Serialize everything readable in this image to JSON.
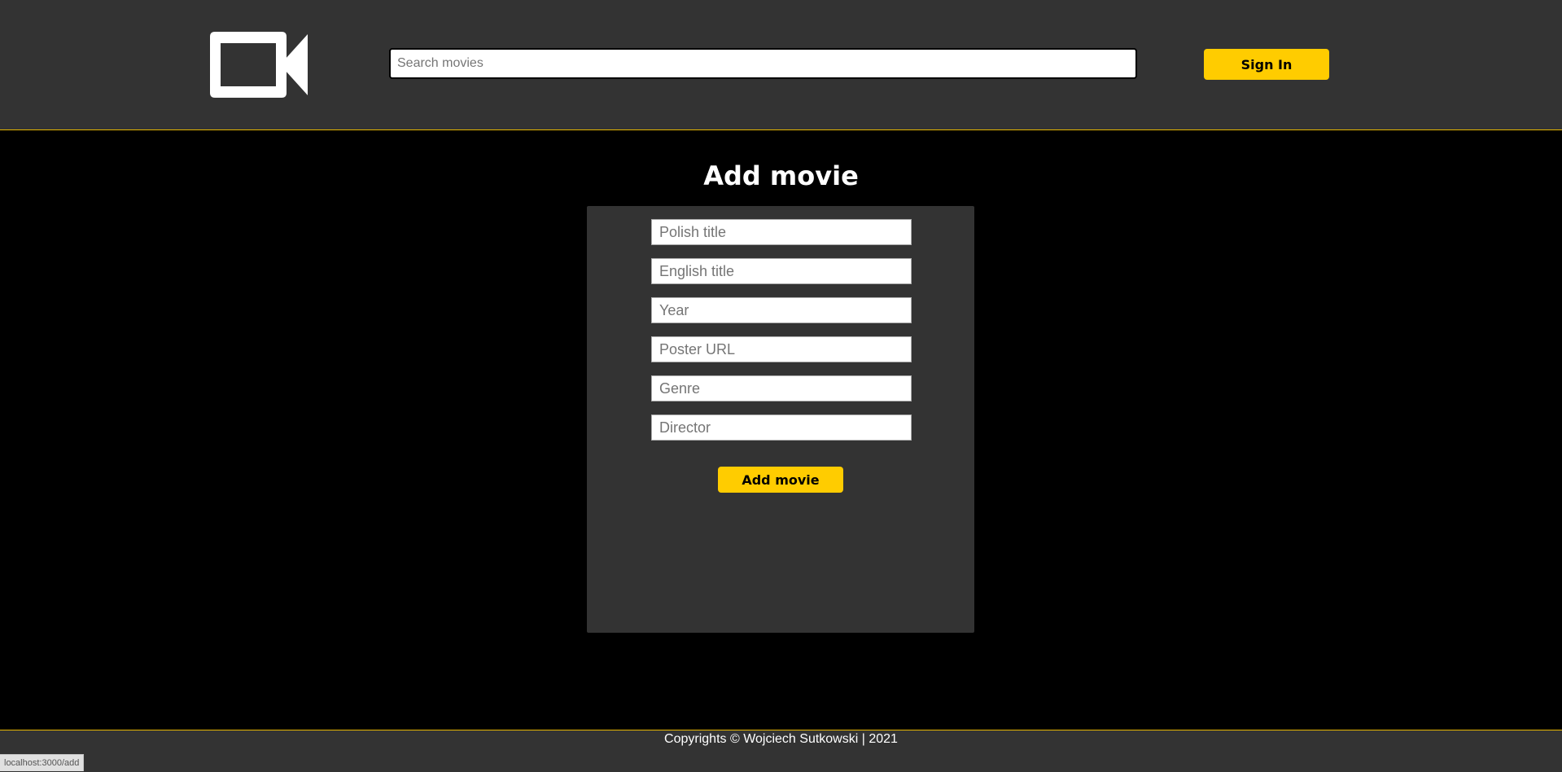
{
  "header": {
    "logo_icon": "video-camera-icon",
    "search_placeholder": "Search movies",
    "signin_label": "Sign In"
  },
  "main": {
    "title": "Add movie",
    "form": {
      "fields": [
        {
          "placeholder": "Polish title",
          "value": ""
        },
        {
          "placeholder": "English title",
          "value": ""
        },
        {
          "placeholder": "Year",
          "value": ""
        },
        {
          "placeholder": "Poster URL",
          "value": ""
        },
        {
          "placeholder": "Genre",
          "value": ""
        },
        {
          "placeholder": "Director",
          "value": ""
        }
      ],
      "submit_label": "Add movie"
    }
  },
  "footer": {
    "text": "Copyrights © Wojciech Sutkowski | 2021"
  },
  "status_bar": {
    "url": "localhost:3000/add"
  },
  "colors": {
    "accent": "#ffcc00",
    "header_bg": "#333333",
    "page_bg": "#000000",
    "border_accent": "#e8b800"
  }
}
